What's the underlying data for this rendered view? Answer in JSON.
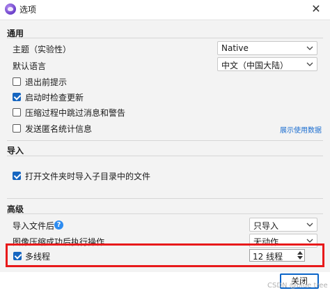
{
  "window": {
    "title": "选项",
    "close_glyph": "✕"
  },
  "sections": {
    "general": {
      "header": "通用",
      "theme_label": "主题（实验性）",
      "theme_value": "Native",
      "language_label": "默认语言",
      "language_value": "中文（中国大陆）",
      "checkboxes": [
        {
          "label": "退出前提示",
          "checked": false
        },
        {
          "label": "启动时检查更新",
          "checked": true
        },
        {
          "label": "压缩过程中跳过消息和警告",
          "checked": false
        },
        {
          "label": "发送匿名统计信息",
          "checked": false
        }
      ],
      "show_data_link": "展示使用数据"
    },
    "import": {
      "header": "导入",
      "checkboxes": [
        {
          "label": "打开文件夹时导入子目录中的文件",
          "checked": true
        }
      ]
    },
    "advanced": {
      "header": "高级",
      "import_files_label": "导入文件后",
      "import_files_value": "只导入",
      "after_success_label": "图像压缩成功后执行操作",
      "after_success_value": "无动作",
      "multithread_label": "多线程",
      "multithread_checked": true,
      "multithread_value": "12 线程"
    }
  },
  "footer": {
    "close_button": "关闭"
  },
  "watermark": "CSDN @blue tree",
  "icons": {
    "app": "app-logo-icon",
    "help": "help-icon",
    "chevron": "chevron-down-icon"
  },
  "colors": {
    "accent": "#1565c0",
    "highlight": "#e8191a",
    "link": "#1a6dd0"
  }
}
